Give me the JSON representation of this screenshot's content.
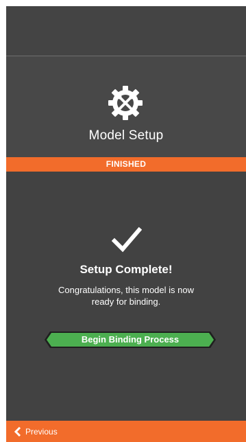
{
  "header": {
    "title": "Model Setup",
    "icon": "gear-wrench-icon"
  },
  "status": {
    "label": "FINISHED"
  },
  "main": {
    "icon": "checkmark-icon",
    "title": "Setup Complete!",
    "message": "Congratulations, this model is now ready for binding.",
    "button_label": "Begin Binding Process"
  },
  "footer": {
    "previous_label": "Previous",
    "icon": "chevron-left-icon"
  },
  "colors": {
    "background": "#424242",
    "accent_orange": "#f26c2b",
    "button_green": "#4caf50",
    "text": "#ffffff"
  }
}
